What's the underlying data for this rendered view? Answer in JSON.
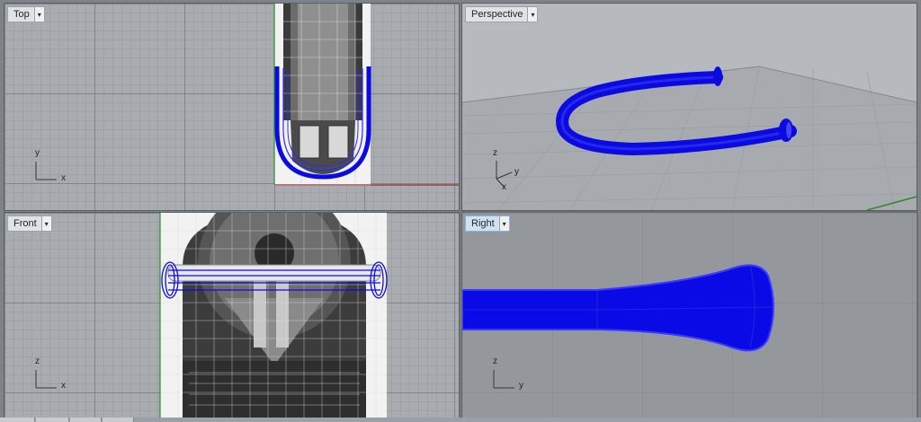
{
  "viewports": {
    "top": {
      "label": "Top",
      "axis_v": "y",
      "axis_h": "x"
    },
    "perspective": {
      "label": "Perspective",
      "axis_a": "z",
      "axis_b": "y",
      "axis_c": "x"
    },
    "front": {
      "label": "Front",
      "axis_v": "z",
      "axis_h": "x"
    },
    "right": {
      "label": "Right",
      "axis_v": "z",
      "axis_h": "y"
    }
  },
  "menu_arrow": "▾",
  "active_viewport": "right",
  "colors": {
    "viewport_bg": "#a8acb1",
    "selection_blue": "#0a0ae6",
    "highlight_blue": "#2b2bff",
    "x_axis_red": "#9a2b2b",
    "y_axis_green": "#2a8a2a"
  }
}
